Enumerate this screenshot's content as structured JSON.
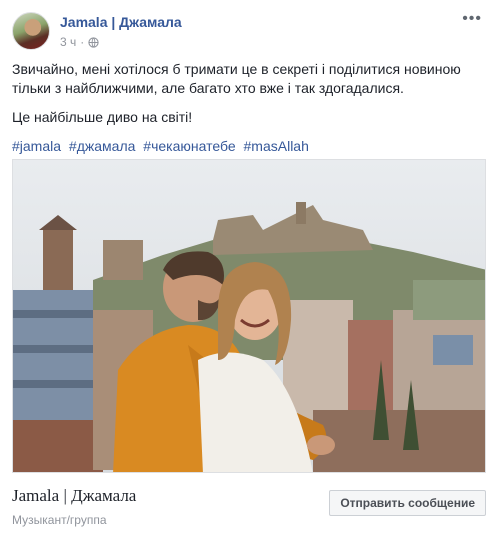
{
  "post": {
    "page_name": "Jamala | Джамала",
    "time": "3 ч",
    "privacy_icon": "globe-icon",
    "menu_icon": "more-options-icon",
    "paragraphs": [
      "Звичайно, мені хотілося б тримати це в секреті і поділитися новиною тільки з найближчими, але багато хто вже і так здогадалися.",
      "Це найбільше диво на світі!"
    ],
    "hashtags": [
      "#jamala",
      "#джамала",
      "#чекаюнатебе",
      "#masAllah"
    ]
  },
  "footer": {
    "page_name": "Jamala | Джамала",
    "category": "Музыкант/группа",
    "message_button": "Отправить сообщение"
  },
  "colors": {
    "link": "#365899",
    "meta": "#90949c",
    "text": "#1d2129",
    "button_bg": "#f5f6f7"
  }
}
